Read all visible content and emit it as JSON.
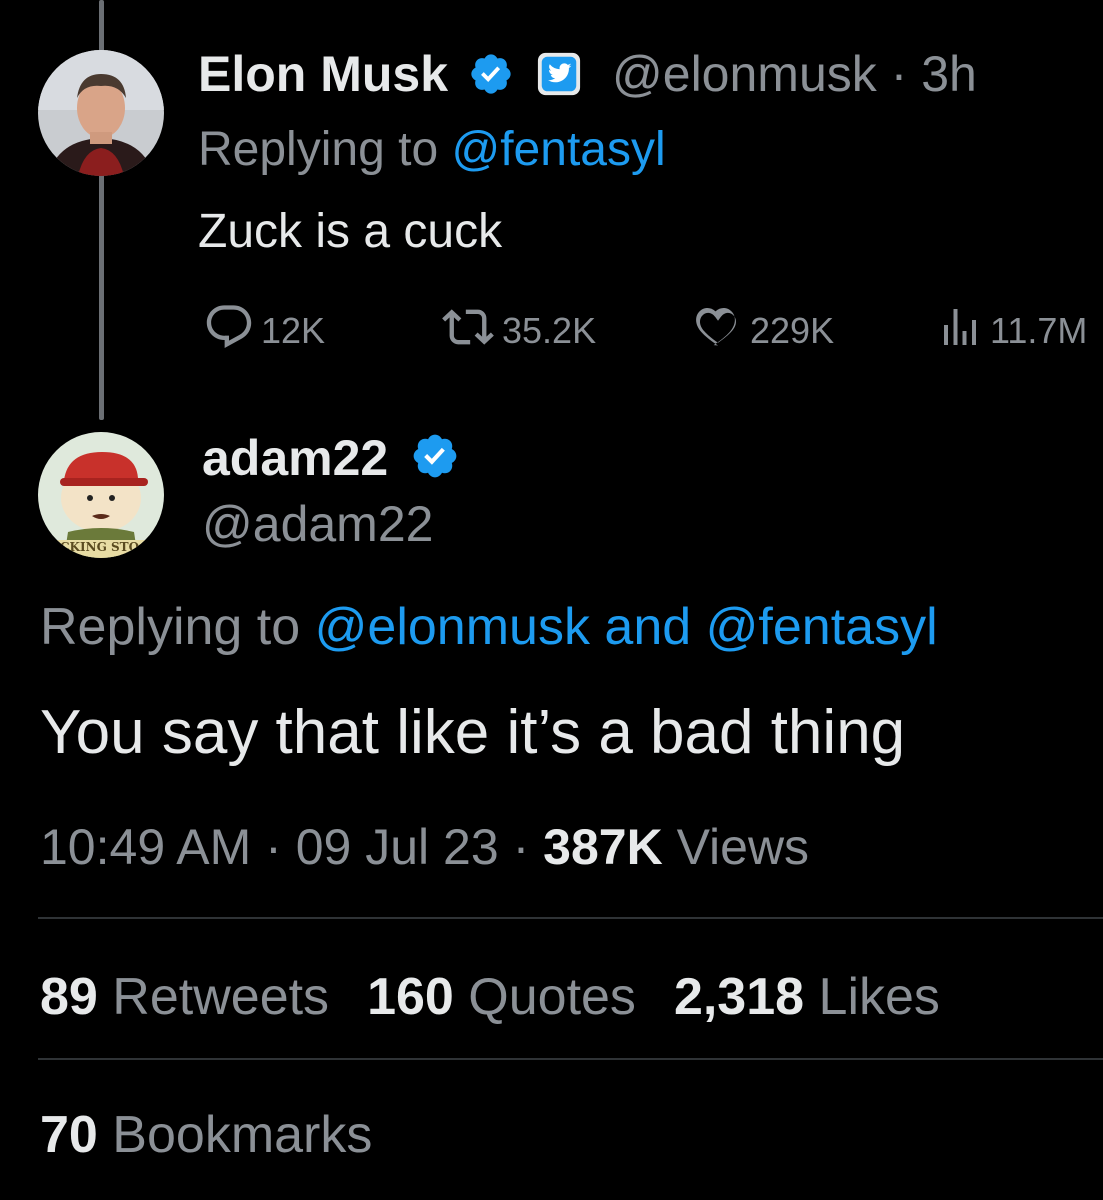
{
  "parent_tweet": {
    "name": "Elon Musk",
    "handle": "@elonmusk",
    "time_separator": "·",
    "time": "3h",
    "replying_prefix": "Replying to",
    "replying_to": "@fentasyl",
    "text": "Zuck is a cuck",
    "metrics": {
      "replies": "12K",
      "retweets": "35.2K",
      "likes": "229K",
      "views": "11.7M"
    }
  },
  "reply_tweet": {
    "name": "adam22",
    "handle": "@adam22",
    "avatar_caption": "CKING STO",
    "replying_prefix": "Replying to",
    "replying_to_1": "@elonmusk",
    "replying_and": "and",
    "replying_to_2": "@fentasyl",
    "text": "You say that like it’s a bad thing",
    "time": "10:49 AM",
    "sep1": "·",
    "date": "09 Jul 23",
    "sep2": "·",
    "views_count": "387K",
    "views_label": "Views",
    "stats": {
      "retweets_count": "89",
      "retweets_label": "Retweets",
      "quotes_count": "160",
      "quotes_label": "Quotes",
      "likes_count": "2,318",
      "likes_label": "Likes",
      "bookmarks_count": "70",
      "bookmarks_label": "Bookmarks"
    }
  },
  "colors": {
    "background": "#000000",
    "text": "#e7e9ea",
    "muted": "#8b9096",
    "link": "#1d9bf0",
    "verified": "#1d9bf0",
    "divider": "#2f3336"
  },
  "icons": [
    "verified-badge-icon",
    "twitter-affiliate-icon",
    "reply-icon",
    "retweet-icon",
    "like-icon",
    "views-icon"
  ]
}
